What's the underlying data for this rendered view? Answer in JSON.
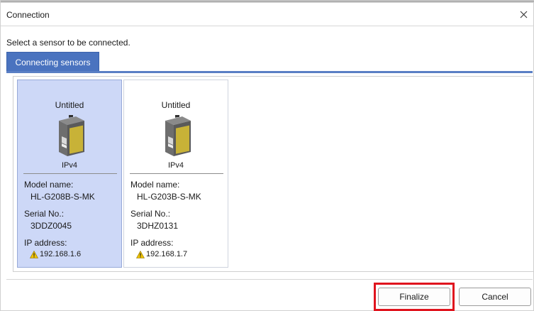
{
  "dialog": {
    "title": "Connection",
    "close_icon": "close-icon",
    "instruction": "Select a sensor to be connected."
  },
  "tabs": [
    {
      "label": "Connecting sensors",
      "active": true
    }
  ],
  "sensors": [
    {
      "title": "Untitled",
      "protocol": "IPv4",
      "model_label": "Model name:",
      "model": "HL-G208B-S-MK",
      "serial_label": "Serial No.:",
      "serial": "3DDZ0045",
      "ip_label": "IP address:",
      "ip": "192.168.1.6",
      "ip_icon": "warning-icon",
      "selected": true
    },
    {
      "title": "Untitled",
      "protocol": "IPv4",
      "model_label": "Model name:",
      "model": "HL-G203B-S-MK",
      "serial_label": "Serial No.:",
      "serial": "3DHZ0131",
      "ip_label": "IP address:",
      "ip": "192.168.1.7",
      "ip_icon": "warning-icon",
      "selected": false
    }
  ],
  "footer": {
    "finalize_label": "Finalize",
    "cancel_label": "Cancel"
  },
  "colors": {
    "tab_active": "#4a73bf",
    "card_selected": "#cdd8f7",
    "highlight": "#e0141e",
    "warning": "#f0c400"
  }
}
